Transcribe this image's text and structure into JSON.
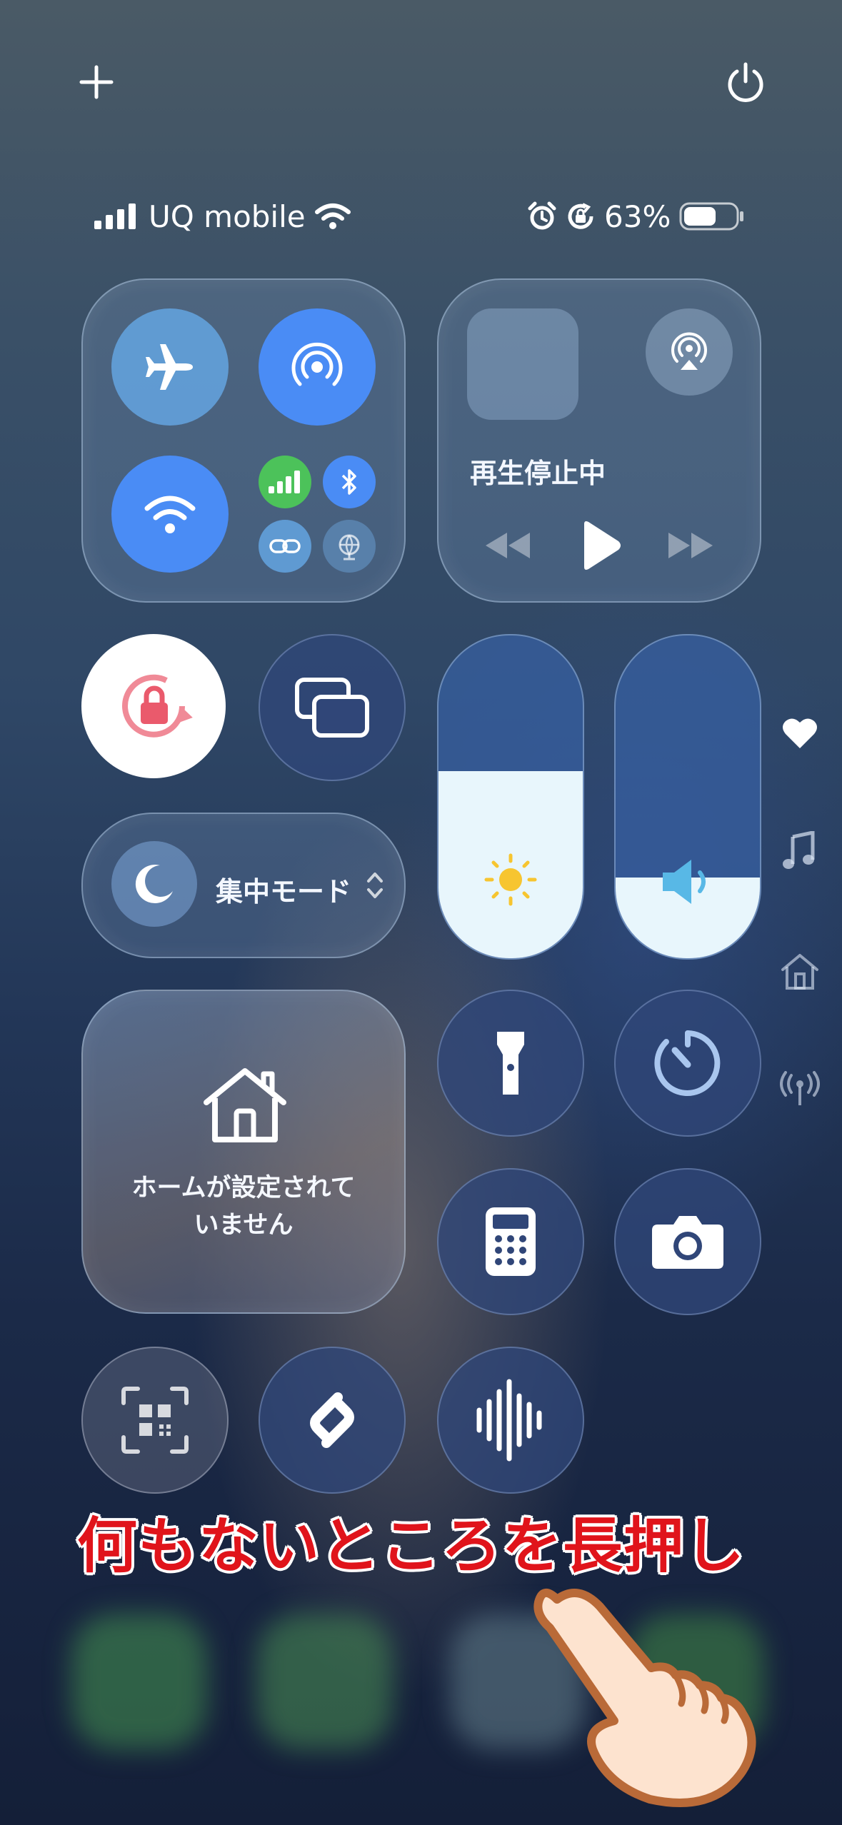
{
  "status_bar": {
    "carrier": "UQ mobile",
    "battery_percent": "63%",
    "battery_level": 0.63,
    "icons": [
      "signal-icon",
      "wifi-icon",
      "alarm-icon",
      "rotation-lock-icon",
      "battery-icon"
    ]
  },
  "top_controls": {
    "add_icon": "plus-icon",
    "power_icon": "power-icon"
  },
  "connectivity": {
    "tiles": [
      "airplane-mode",
      "airdrop",
      "wifi",
      "cellular-data",
      "bluetooth",
      "personal-hotspot",
      "vpn"
    ],
    "colors": {
      "active_blue": "#4a8cf5",
      "cellular_green": "#4cc25a"
    }
  },
  "media": {
    "status": "再生停止中",
    "controls": [
      "rewind-icon",
      "play-icon",
      "fast-forward-icon"
    ]
  },
  "sliders": {
    "brightness_level": 0.58,
    "volume_level": 0.25
  },
  "focus": {
    "label": "集中モード"
  },
  "home": {
    "line1": "ホームが設定されて",
    "line2": "いません"
  },
  "tiles": [
    "screen-rotation-lock",
    "screen-mirroring",
    "flashlight",
    "timer",
    "calculator",
    "camera",
    "code-scanner",
    "shazam",
    "voice-memo"
  ],
  "side_pager": [
    "favorites-heart-icon",
    "music-note-icon",
    "home-icon",
    "connectivity-icon"
  ],
  "annotation": {
    "text": "何もないところを長押し",
    "color": "#e0141b"
  }
}
